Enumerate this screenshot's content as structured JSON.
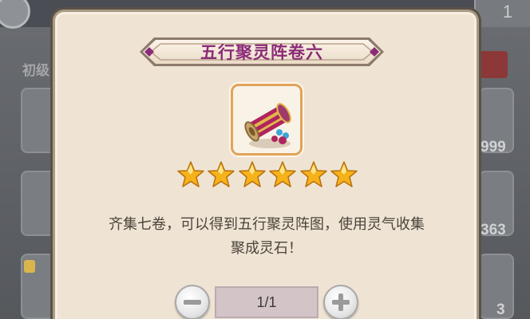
{
  "background": {
    "left_label": "初级",
    "top_right_digit": "1",
    "slot_counts": [
      "999",
      "363",
      "3"
    ]
  },
  "dialog": {
    "title": "五行聚灵阵卷六",
    "item_icon": "scroll-icon",
    "star_count": 6,
    "description_line1": "齐集七卷，可以得到五行聚灵阵图，使用灵气收集",
    "description_line2": "聚成灵石！",
    "quantity": "1/1",
    "minus_icon": "minus-icon",
    "plus_icon": "plus-icon"
  },
  "colors": {
    "title": "#8c2b77",
    "panel": "#efe4d3",
    "star": "#f6b21a",
    "quantity_field": "#d3c4c8"
  }
}
